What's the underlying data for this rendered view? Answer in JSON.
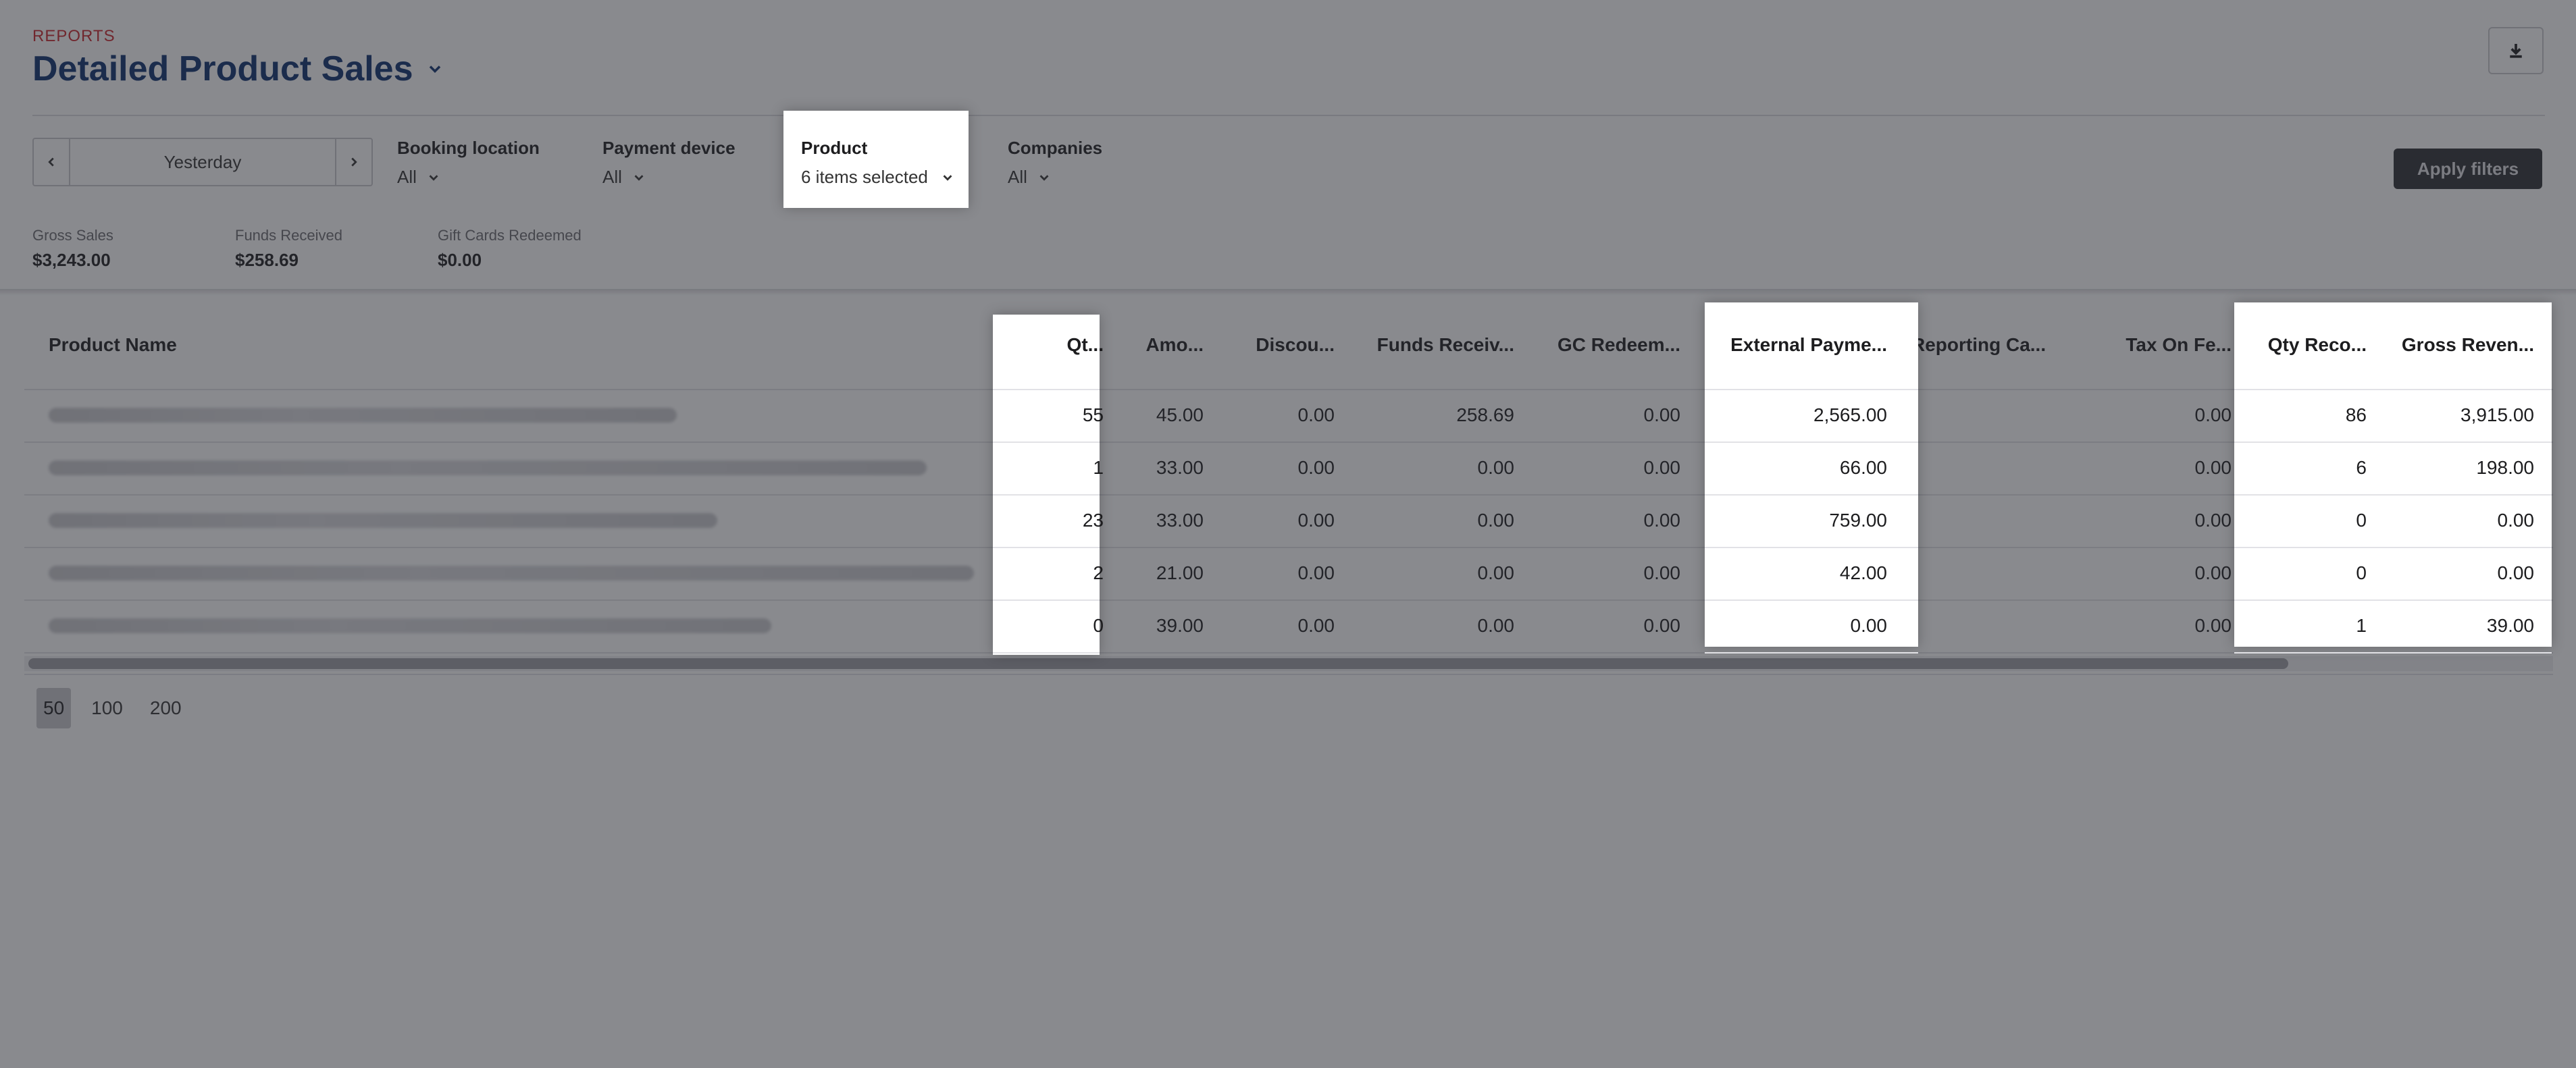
{
  "header": {
    "section_label": "REPORTS",
    "title": "Detailed Product Sales"
  },
  "filters": {
    "date_value": "Yesterday",
    "booking_location": {
      "label": "Booking location",
      "value": "All"
    },
    "payment_device": {
      "label": "Payment device",
      "value": "All"
    },
    "product": {
      "label": "Product",
      "value": "6 items selected"
    },
    "companies": {
      "label": "Companies",
      "value": "All"
    },
    "apply_label": "Apply filters"
  },
  "summary": [
    {
      "label": "Gross Sales",
      "value": "$3,243.00"
    },
    {
      "label": "Funds Received",
      "value": "$258.69"
    },
    {
      "label": "Gift Cards Redeemed",
      "value": "$0.00"
    }
  ],
  "table": {
    "columns": [
      "Product Name",
      "Qt...",
      "Amo...",
      "Discou...",
      "Funds Receiv...",
      "GC Redeem...",
      "External Payme...",
      "Reporting Ca...",
      "Tax On Fe...",
      "Qty Reco...",
      "Gross Reven..."
    ],
    "rows": [
      {
        "qty": "55",
        "amount": "45.00",
        "discount": "0.00",
        "funds": "258.69",
        "gc": "0.00",
        "external": "2,565.00",
        "reporting": "",
        "tax": "0.00",
        "qty_rec": "86",
        "gross": "3,915.00"
      },
      {
        "qty": "1",
        "amount": "33.00",
        "discount": "0.00",
        "funds": "0.00",
        "gc": "0.00",
        "external": "66.00",
        "reporting": "",
        "tax": "0.00",
        "qty_rec": "6",
        "gross": "198.00"
      },
      {
        "qty": "23",
        "amount": "33.00",
        "discount": "0.00",
        "funds": "0.00",
        "gc": "0.00",
        "external": "759.00",
        "reporting": "",
        "tax": "0.00",
        "qty_rec": "0",
        "gross": "0.00"
      },
      {
        "qty": "2",
        "amount": "21.00",
        "discount": "0.00",
        "funds": "0.00",
        "gc": "0.00",
        "external": "42.00",
        "reporting": "",
        "tax": "0.00",
        "qty_rec": "0",
        "gross": "0.00"
      },
      {
        "qty": "0",
        "amount": "39.00",
        "discount": "0.00",
        "funds": "0.00",
        "gc": "0.00",
        "external": "0.00",
        "reporting": "",
        "tax": "0.00",
        "qty_rec": "1",
        "gross": "39.00"
      }
    ]
  },
  "pager": {
    "options": [
      "50",
      "100",
      "200"
    ],
    "selected": "50"
  },
  "icons": {
    "download": "download-icon",
    "prev": "chevron-left-icon",
    "next": "chevron-right-icon",
    "dropdown": "chevron-down-icon"
  }
}
